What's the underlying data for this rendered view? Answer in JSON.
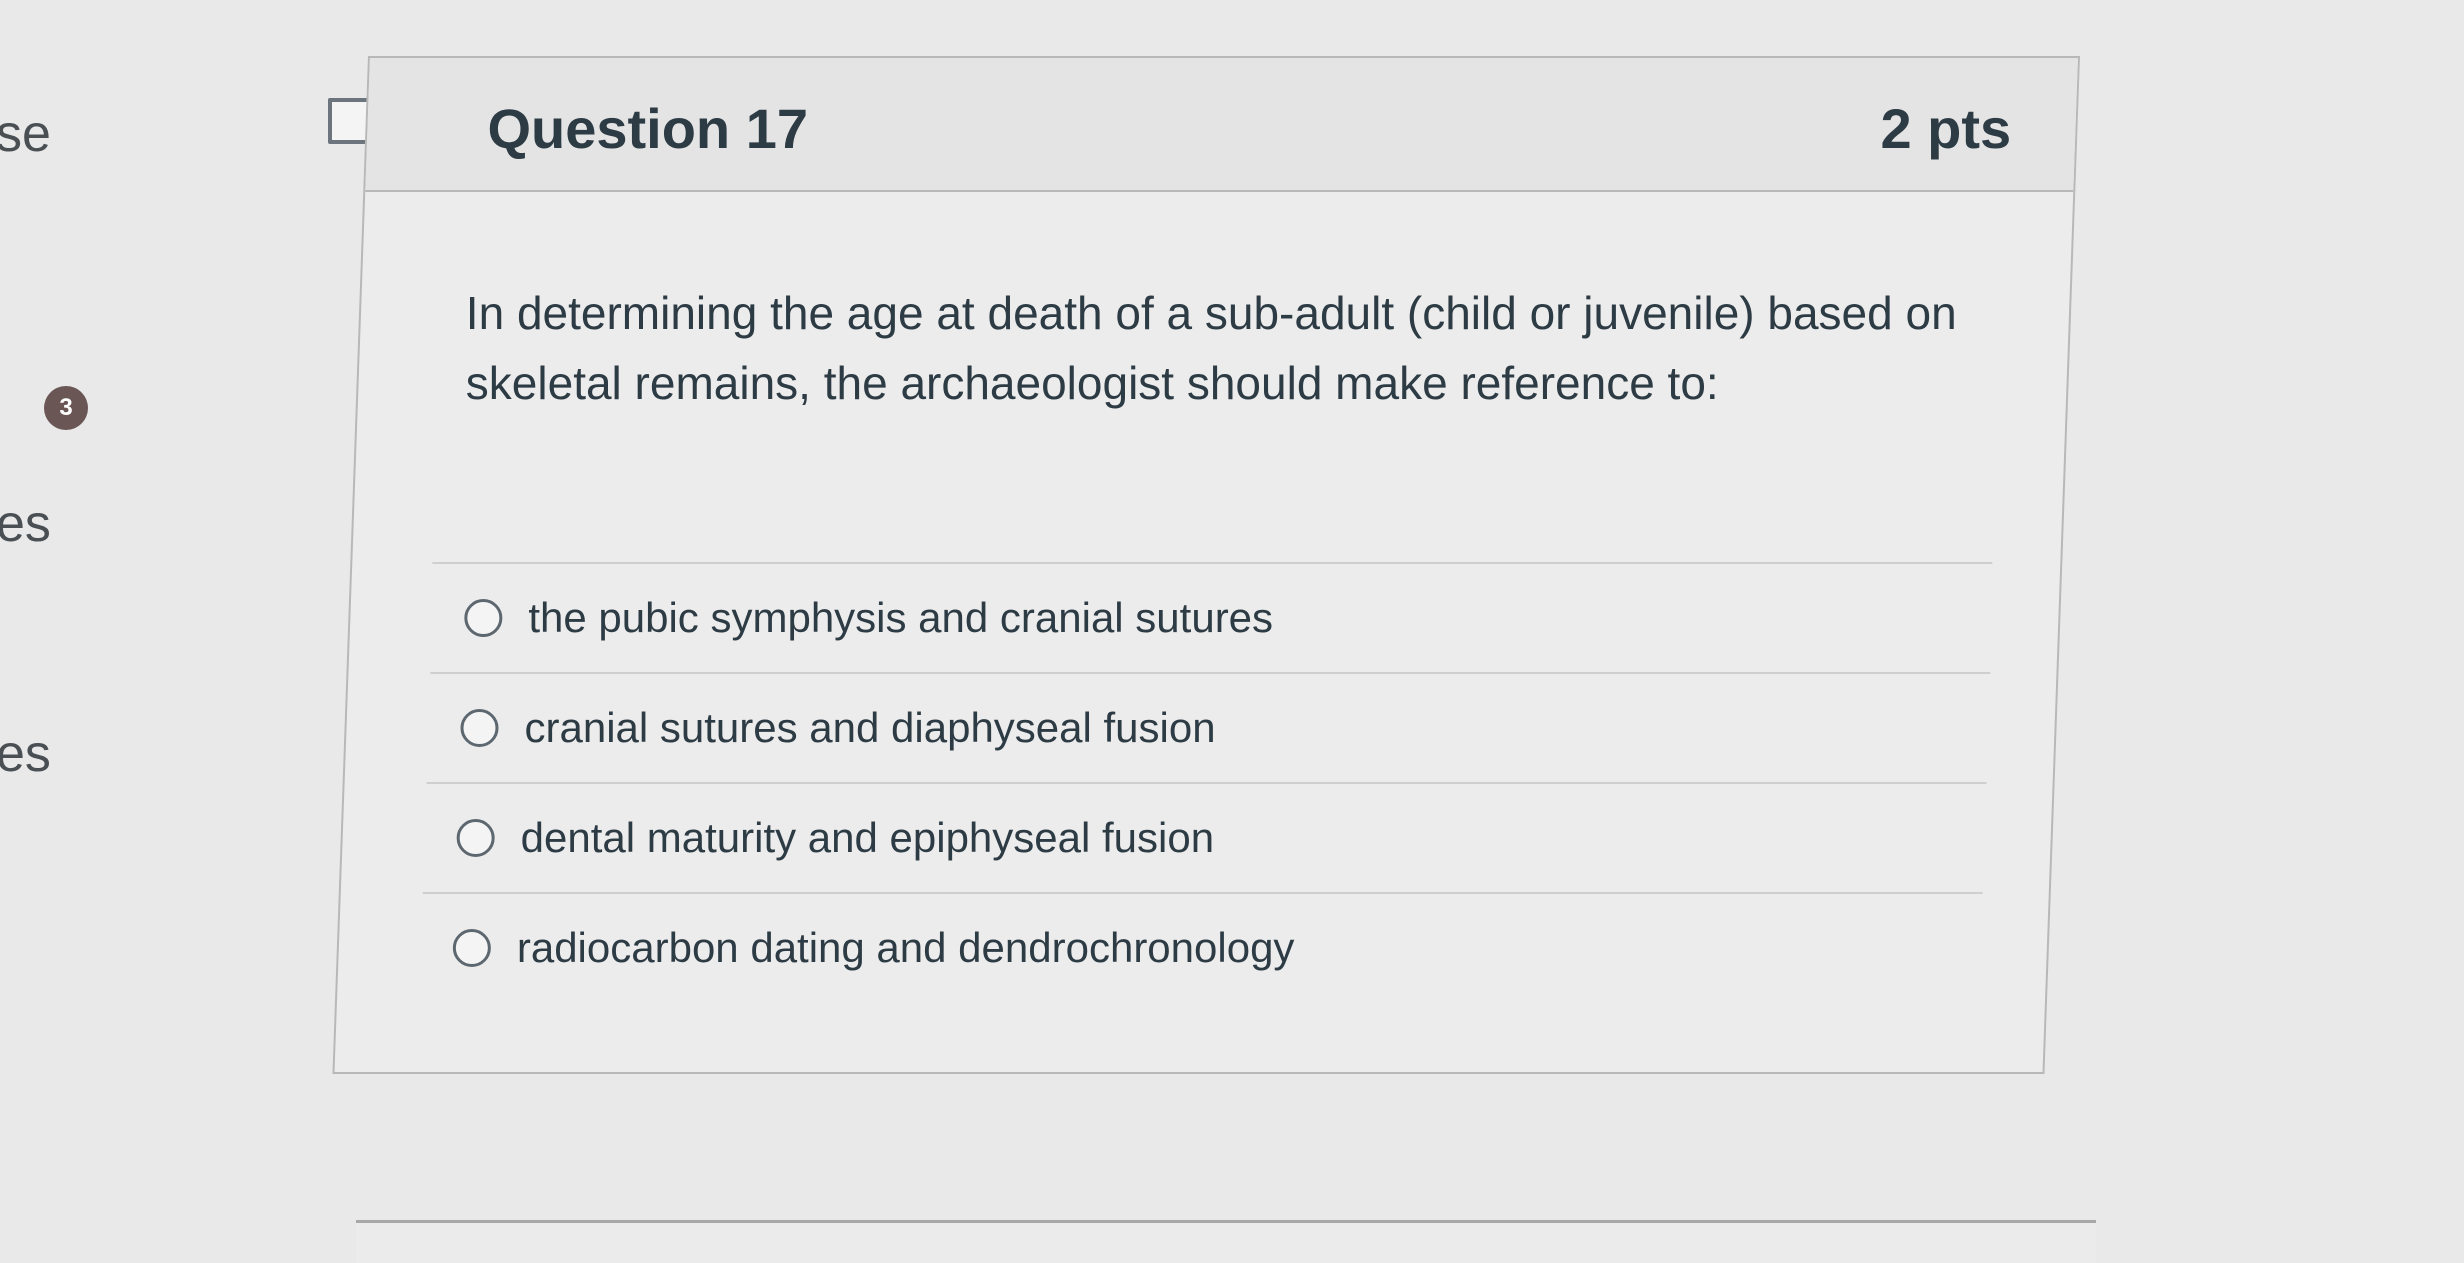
{
  "sidebar": {
    "items": [
      {
        "text": "se"
      },
      {
        "text": "es"
      },
      {
        "text": "es"
      }
    ],
    "badge": "3"
  },
  "question": {
    "title": "Question 17",
    "points": "2 pts",
    "text": "In determining the age at death of a sub-adult (child or juvenile) based on skeletal remains, the archaeologist should make reference to:",
    "answers": [
      {
        "label": "the pubic symphysis and cranial sutures",
        "selected": false
      },
      {
        "label": "cranial sutures and diaphyseal fusion",
        "selected": false
      },
      {
        "label": "dental maturity and epiphyseal fusion",
        "selected": false
      },
      {
        "label": "radiocarbon dating and dendrochronology",
        "selected": false
      }
    ]
  },
  "icons": {
    "flag": "flag-question-icon"
  },
  "colors": {
    "background": "#e9e9e9",
    "text": "#2d3b45",
    "badge": "#6b5656",
    "border": "#b8b8b8"
  }
}
